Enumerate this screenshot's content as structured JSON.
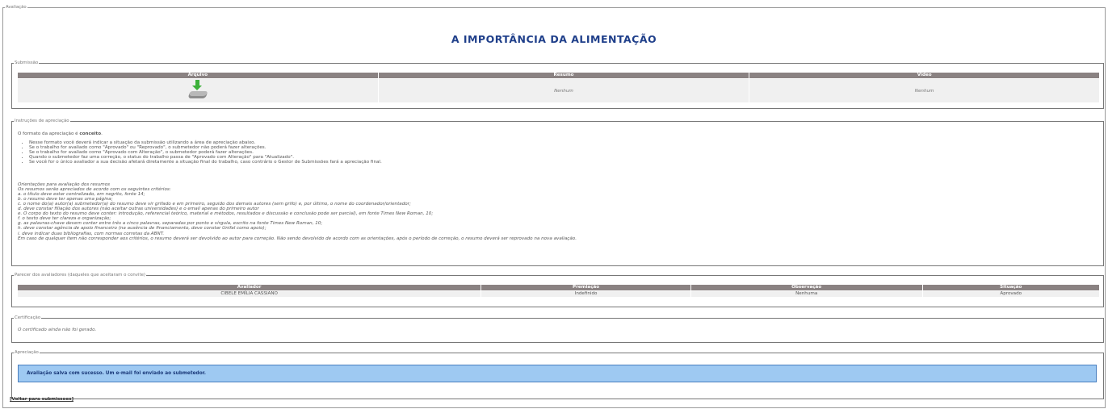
{
  "page": {
    "legend": "Avaliação",
    "title": "A IMPORTÂNCIA DA ALIMENTAÇÃO"
  },
  "submissao": {
    "legend": "Submissão",
    "headers": [
      "Arquivo",
      "Resumo",
      "Vídeo"
    ],
    "resumo": "Nenhum",
    "video": "Nenhum",
    "file_icon": "download-file-icon"
  },
  "instrucoes": {
    "legend": "Instruções de apreciação",
    "intro_prefix": "O formato da apreciação é ",
    "intro_bold": "conceito",
    "intro_suffix": ".",
    "bullets": [
      "Nesse formato você deverá indicar a situação da submissão utilizando a área de apreciação abaixo.",
      "Se o trabalho for avaliado como \"Aprovado\" ou \"Reprovado\", o submetedor não poderá fazer alterações.",
      "Se o trabalho for avaliado como \"Aprovado com Alteração\", o submetedor poderá fazer alterações.",
      "Quando o submetedor faz uma correção, o status do trabalho passa de \"Aprovado com Alteração\" para \"Atualizado\".",
      "Se você for o único avaliador a sua decisão afetará diretamente a situação final do trabalho, caso contrário o Gestor de Submissões fará a apreciação final."
    ],
    "orientacoes": [
      "Orientações para avaliação dos resumos",
      "Os resumos serão apreciados de acordo com os seguintes critérios:",
      "a. o título deve estar centralizado, em negrito, fonte 14;",
      "b. o resumo deve ter apenas uma página;",
      "c. o nome do(a) autor(a) submetedor(a) do resumo deve vir grifado e em primeiro, seguido dos demais autores (sem grifo) e, por último, o nome do coordenador/orientador;",
      "d. deve constar filiação dos autores (não aceitar outras universidades) e o email apenas do primeiro autor",
      "e. O corpo do texto do resumo deve conter: introdução, referencial teórico, material e métodos, resultados e discussão e conclusão pode ser parcial), em fonte Times New Roman, 10;",
      "f. o texto deve ter clareza e organização;",
      "g. as palavras-chave devem conter entre três a cinco palavras, separadas por ponto e vírgula, escrito na fonte Times New Roman, 10;",
      "h. deve constar agência de apoio financeiro (na ausência de financiamento, deve constar Unifal como apoio);",
      "i. deve indicar duas bibliografias, com normas corretas da ABNT.",
      "Em caso de qualquer item não corresponder aos critérios, o resumo deverá ser devolvido ao autor para correção. Não sendo devolvido de acordo com as orientações, após o período de correção, o resumo deverá ser reprovado na nova avaliação."
    ]
  },
  "parecer": {
    "legend": "Parecer dos avaliadores (daqueles que aceitaram o convite)",
    "headers": [
      "Avaliador",
      "Premiação",
      "Observação",
      "Situação"
    ],
    "rows": [
      {
        "avaliador": "CIBELE EMÍLIA CASSIANO",
        "premiacao": "Indefinido",
        "observacao": "Nenhuma",
        "situacao": "Aprovado"
      }
    ]
  },
  "certificacao": {
    "legend": "Certificação",
    "text": "O certificado ainda não foi gerado."
  },
  "apreciacao": {
    "legend": "Apreciação",
    "success_message": "Avaliação salva com sucesso. Um e-mail foi enviado ao submetedor."
  },
  "back_link": "[Voltar para submissoes]",
  "colors": {
    "title": "#1f3f8a",
    "header_bg": "#8a8282",
    "success_bg": "#9ec9f2",
    "success_border": "#4a7fbf"
  }
}
